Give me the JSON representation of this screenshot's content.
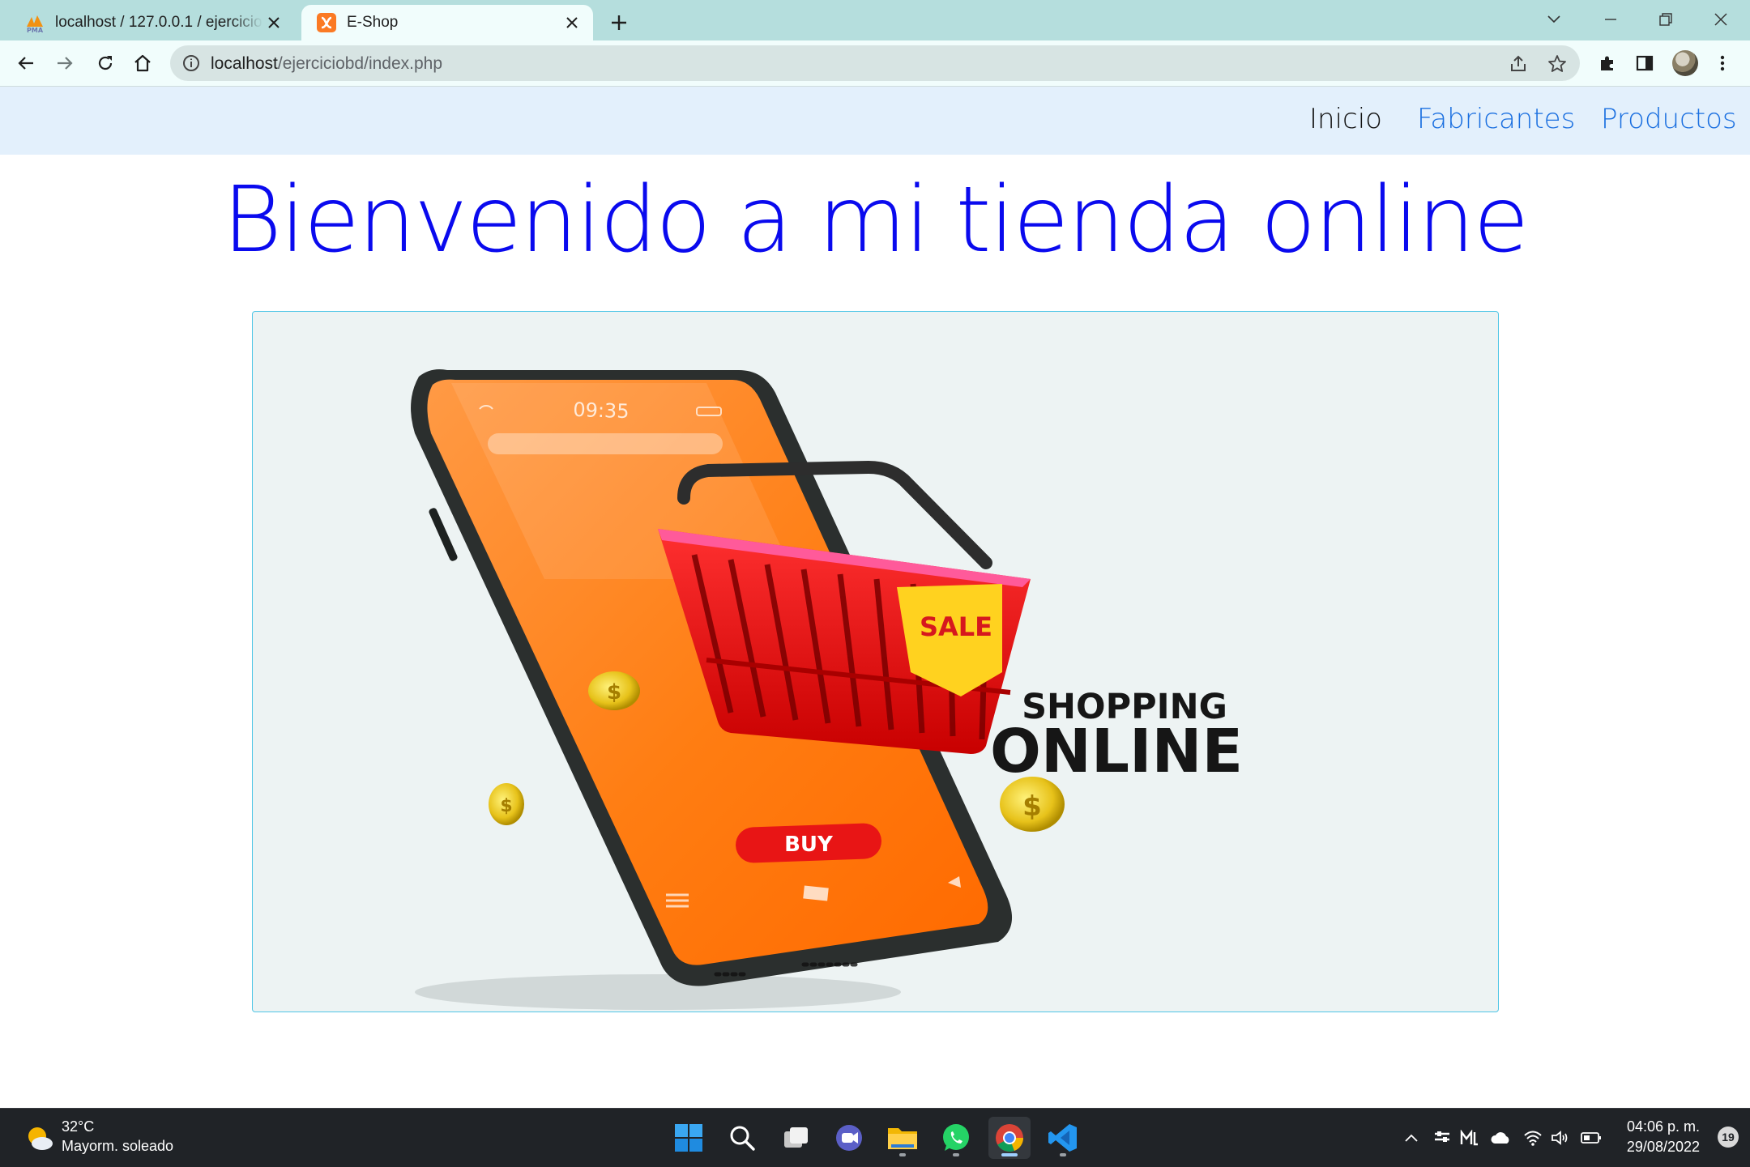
{
  "browser": {
    "tabs": [
      {
        "title": "localhost / 127.0.0.1 / ejercicio / ",
        "favicon": "phpmyadmin-icon",
        "active": false
      },
      {
        "title": "E-Shop",
        "favicon": "xampp-icon",
        "active": true
      }
    ],
    "url_host": "localhost",
    "url_path": "/ejerciciobd/index.php"
  },
  "page": {
    "nav": {
      "items": [
        {
          "label": "Inicio",
          "active": true
        },
        {
          "label": "Fabricantes",
          "active": false
        },
        {
          "label": "Productos",
          "active": false
        }
      ]
    },
    "title": "Bienvenido a mi tienda online",
    "hero": {
      "phone_time": "09:35",
      "buy_label": "BUY",
      "sale_label": "SALE",
      "headline_small": "SHOPPING",
      "headline_big": "ONLINE"
    }
  },
  "taskbar": {
    "weather_temp": "32°C",
    "weather_desc": "Mayorm. soleado",
    "clock_time": "04:06 p. m.",
    "clock_date": "29/08/2022",
    "notification_count": "19"
  },
  "colors": {
    "title": "#0a0aee",
    "nav_link": "#1a6fe0",
    "navbar_bg": "#e3f0fc",
    "hero_border": "#4fc6e6",
    "tabstrip": "#b5dedd"
  }
}
